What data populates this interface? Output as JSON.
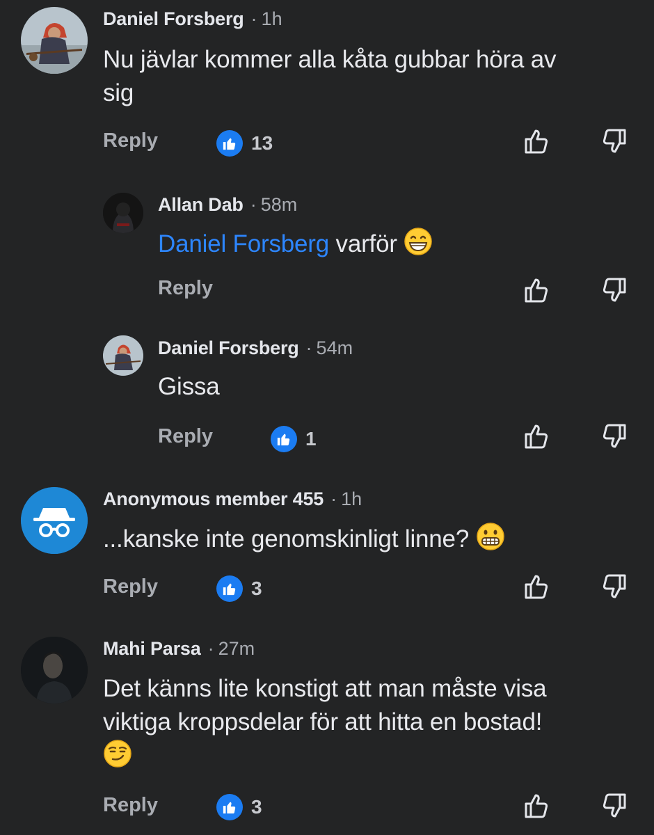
{
  "comments": [
    {
      "author": "Daniel Forsberg",
      "time": "1h",
      "text_lines": [
        "Nu jävlar kommer alla kåta gubbar höra av",
        "sig"
      ],
      "reply_label": "Reply",
      "like_count": "13"
    },
    {
      "author": "Allan Dab",
      "time": "58m",
      "mention": "Daniel Forsberg",
      "text": "varför",
      "emoji": "beaming-face-emoji",
      "reply_label": "Reply"
    },
    {
      "author": "Daniel Forsberg",
      "time": "54m",
      "text": "Gissa",
      "reply_label": "Reply",
      "like_count": "1"
    },
    {
      "author": "Anonymous member 455",
      "time": "1h",
      "text": "...kanske inte genomskinligt linne?",
      "emoji": "grimacing-face-emoji",
      "reply_label": "Reply",
      "like_count": "3"
    },
    {
      "author": "Mahi Parsa",
      "time": "27m",
      "text_lines": [
        "Det känns lite konstigt att man måste visa",
        "viktiga kroppsdelar för att hitta en bostad!"
      ],
      "emoji": "smirking-face-emoji",
      "reply_label": "Reply",
      "like_count": "3"
    }
  ],
  "separator": "·",
  "colors": {
    "background": "#232425",
    "mention": "#2d86ff",
    "like_badge": "#1b7cf2",
    "anonymous_avatar": "#1e88d6",
    "muted_text": "#a9acb2"
  },
  "icons": {
    "like_badge": "thumbs-up-icon",
    "upvote": "thumbs-up-outline-icon",
    "downvote": "thumbs-down-outline-icon",
    "anonymous_avatar": "incognito-icon"
  }
}
